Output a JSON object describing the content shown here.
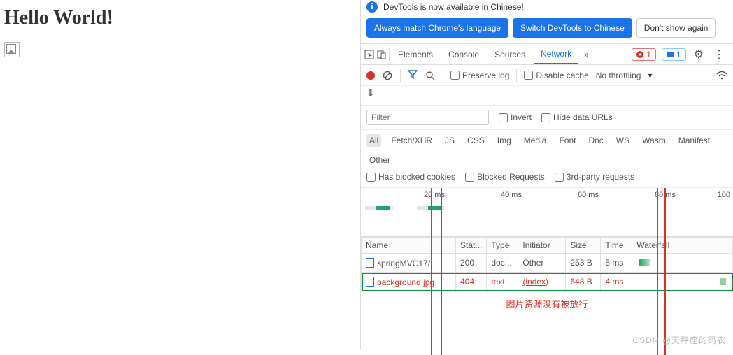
{
  "page": {
    "heading": "Hello World!"
  },
  "infobar": {
    "text": "DevTools is now available in Chinese!"
  },
  "lang_buttons": {
    "match": "Always match Chrome's language",
    "switch": "Switch DevTools to Chinese",
    "dismiss": "Don't show again"
  },
  "tabs": {
    "elements": "Elements",
    "console": "Console",
    "sources": "Sources",
    "network": "Network",
    "errors_count": "1",
    "messages_count": "1"
  },
  "toolbar": {
    "preserve": "Preserve log",
    "disable_cache": "Disable cache",
    "throttling": "No throttling"
  },
  "filter": {
    "placeholder": "Filter",
    "invert": "Invert",
    "hide_urls": "Hide data URLs"
  },
  "types": {
    "all": "All",
    "fetch": "Fetch/XHR",
    "js": "JS",
    "css": "CSS",
    "img": "Img",
    "media": "Media",
    "font": "Font",
    "doc": "Doc",
    "ws": "WS",
    "wasm": "Wasm",
    "manifest": "Manifest",
    "other": "Other"
  },
  "check_row": {
    "blocked_cookies": "Has blocked cookies",
    "blocked_requests": "Blocked Requests",
    "third_party": "3rd-party requests"
  },
  "ruler": {
    "t20": "20 ms",
    "t40": "40 ms",
    "t60": "60 ms",
    "t80": "80 ms",
    "t100": "100"
  },
  "table": {
    "headers": {
      "name": "Name",
      "status": "Stat...",
      "type": "Type",
      "initiator": "Initiator",
      "size": "Size",
      "time": "Time",
      "waterfall": "Waterfall"
    },
    "rows": [
      {
        "name": "springMVC17/",
        "status": "200",
        "type": "doc...",
        "initiator": "Other",
        "size": "253 B",
        "time": "5 ms",
        "error": false
      },
      {
        "name": "background.jpg",
        "status": "404",
        "type": "text...",
        "initiator": "(index)",
        "size": "648 B",
        "time": "4 ms",
        "error": true
      }
    ]
  },
  "annotation": "图片资源没有被放行",
  "watermark": "CSDN @天秤座的码农"
}
